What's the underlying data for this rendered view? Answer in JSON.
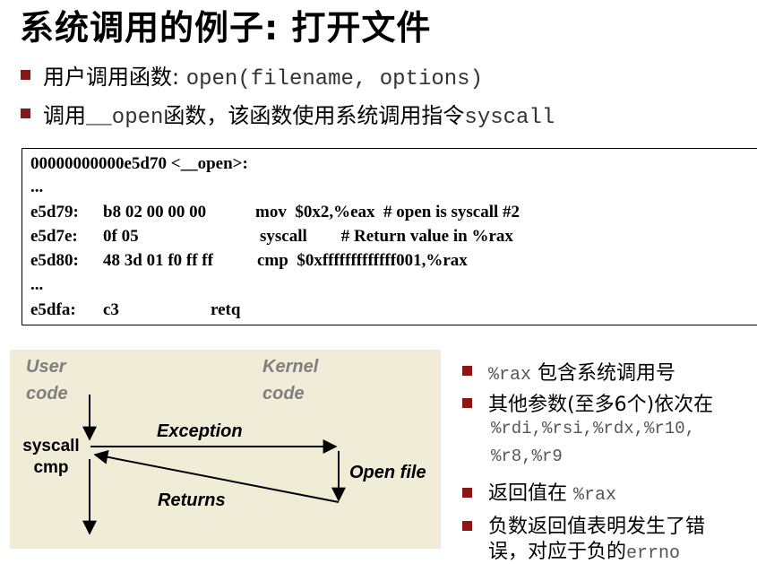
{
  "title": "系统调用的例子: 打开文件",
  "bullets": [
    {
      "text": "用户调用函数",
      "sep": ": ",
      "code": "open(filename, options)"
    },
    {
      "prefix": "调用",
      "code": "__open",
      "suffix": "函数，该函数使用系统调用指令",
      "code2": "syscall"
    }
  ],
  "code_block": {
    "header": "00000000000e5d70 <__open>:",
    "ellipsis1": "...",
    "rows": [
      {
        "addr": "e5d79:",
        "bytes": "b8 02 00 00 00",
        "instr": "mov  $0x2,%eax  # open is syscall #2"
      },
      {
        "addr": "e5d7e:",
        "bytes": "0f 05",
        "instr": "syscall        # Return value in %rax"
      },
      {
        "addr": "e5d80:",
        "bytes": "48 3d 01 f0 ff ff",
        "instr": "cmp  $0xfffffffffffff001,%rax"
      }
    ],
    "ellipsis2": "...",
    "last": {
      "addr": "e5dfa:",
      "bytes": "c3",
      "instr": "retq"
    }
  },
  "diagram": {
    "user_line1": "User",
    "user_line2": "code",
    "kernel_line1": "Kernel",
    "kernel_line2": "code",
    "syscall_label": "syscall",
    "cmp_label": "cmp",
    "exception": "Exception",
    "open_file": "Open file",
    "returns": "Returns"
  },
  "right_bullets": {
    "b1_code": "%rax",
    "b1_text": "包含系统调用号",
    "b2_text": "其他参数(至多6个)依次在",
    "b2_regs1": "%rdi,%rsi,%rdx,%r10,",
    "b2_regs2": "%r8,%r9",
    "b3_text": "返回值在",
    "b3_code": "%rax",
    "b4_line1": "负数返回值表明发生了错",
    "b4_line2": "误，对应于负的",
    "b4_code": "errno"
  },
  "colors": {
    "bullet": "#8c1515",
    "panel": "#f0ecd8",
    "label_gray": "#7f7f7f"
  }
}
